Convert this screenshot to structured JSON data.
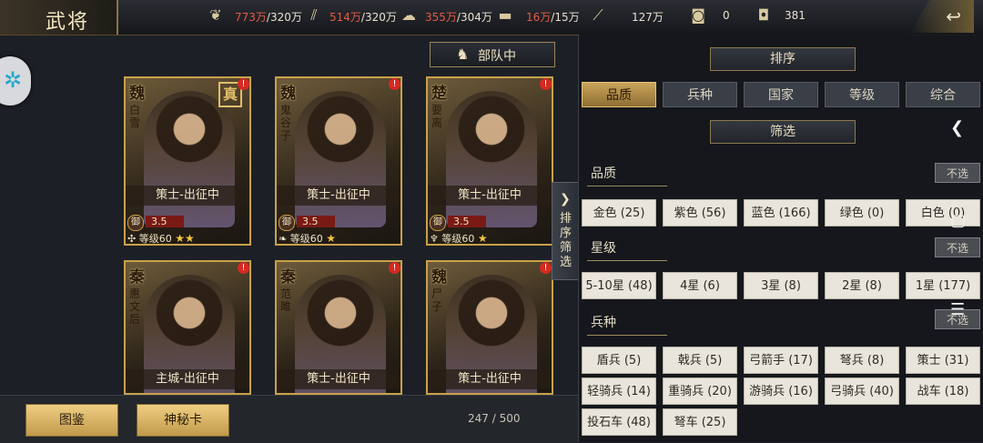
{
  "header": {
    "title": "武将"
  },
  "resources": [
    {
      "icon": "wheat-icon",
      "current": "773万",
      "cap": "/320万"
    },
    {
      "icon": "wood-icon",
      "current": "514万",
      "cap": "/320万"
    },
    {
      "icon": "stone-icon",
      "current": "355万",
      "cap": "/304万"
    },
    {
      "icon": "iron-icon",
      "current": "16万",
      "cap": "/15万"
    },
    {
      "icon": "order-icon",
      "value": "127万"
    },
    {
      "icon": "gold-icon",
      "value": "0"
    },
    {
      "icon": "silver-icon",
      "value": "381"
    }
  ],
  "troops_label": "部队中",
  "cards": [
    {
      "kingdom": "魏",
      "name": "白雪",
      "status": "策士-出征中",
      "def": "3.5",
      "level": "等级60",
      "stars": "★★",
      "badge": "真"
    },
    {
      "kingdom": "魏",
      "name": "鬼谷子",
      "status": "策士-出征中",
      "def": "3.5",
      "level": "等级60",
      "stars": "★"
    },
    {
      "kingdom": "楚",
      "name": "要离",
      "status": "策士-出征中",
      "def": "3.5",
      "level": "等级60",
      "stars": "★"
    },
    {
      "kingdom": "秦",
      "name": "惠文后",
      "status": "主城-出征中"
    },
    {
      "kingdom": "秦",
      "name": "范雎",
      "status": "策士-出征中"
    },
    {
      "kingdom": "魏",
      "name": "尸子",
      "status": "策士-出征中"
    }
  ],
  "def_label": "御",
  "bottom": {
    "collection": "图鉴",
    "mystery": "神秘卡",
    "count": "247 / 500"
  },
  "panel": {
    "sort_title": "排序",
    "tabs": [
      "品质",
      "兵种",
      "国家",
      "等级",
      "综合"
    ],
    "filter_title": "筛选",
    "unselect": "不选",
    "quality_title": "品质",
    "quality": [
      "金色 (25)",
      "紫色 (56)",
      "蓝色 (166)",
      "绿色 (0)",
      "白色 (0)"
    ],
    "star_title": "星级",
    "stars": [
      "5-10星 (48)",
      "4星 (6)",
      "3星 (8)",
      "2星 (8)",
      "1星 (177)"
    ],
    "troop_title": "兵种",
    "troops_row1": [
      "盾兵 (5)",
      "戟兵 (5)",
      "弓箭手 (17)",
      "弩兵 (8)",
      "策士 (31)"
    ],
    "troops_row2": [
      "轻骑兵 (14)",
      "重骑兵 (20)",
      "游骑兵 (16)",
      "弓骑兵 (40)",
      "战车 (18)"
    ],
    "troops_row3": [
      "投石车 (48)",
      "弩车 (25)"
    ]
  },
  "handle_text": "排序筛选",
  "colors": {
    "gold": "#c9a14a",
    "alert": "#d42a22",
    "panel": "#14171c"
  }
}
